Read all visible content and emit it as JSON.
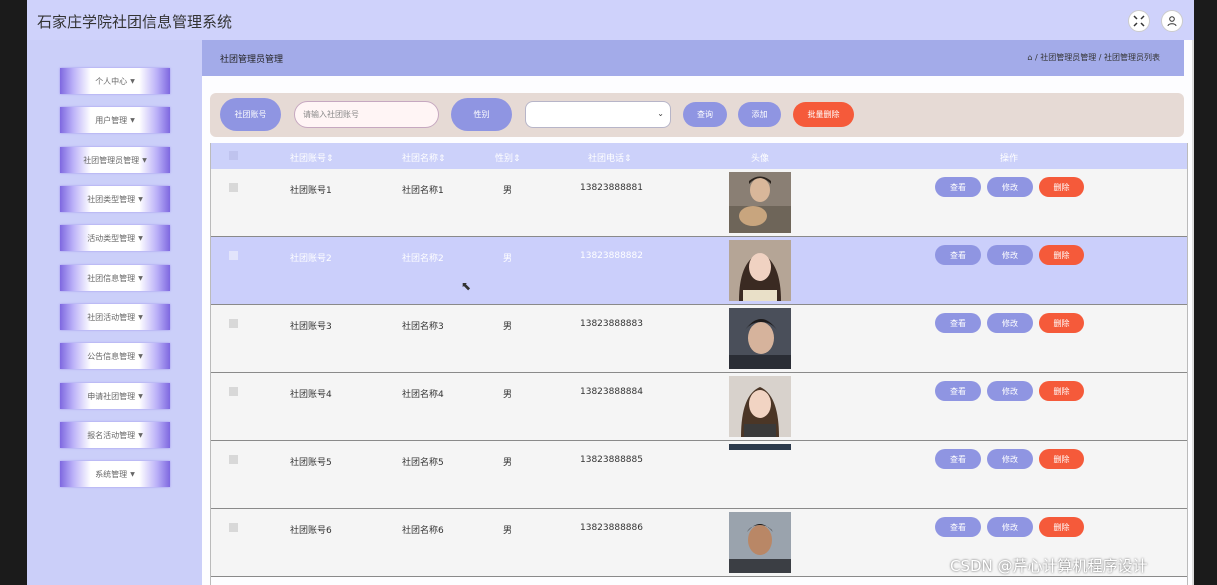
{
  "app": {
    "title": "石家庄学院社团信息管理系统"
  },
  "topbar": {
    "fullscreen_icon": "fullscreen-icon",
    "user_icon": "user-icon"
  },
  "sidebar": {
    "items": [
      {
        "label": "个人中心"
      },
      {
        "label": "用户管理"
      },
      {
        "label": "社团管理员管理"
      },
      {
        "label": "社团类型管理"
      },
      {
        "label": "活动类型管理"
      },
      {
        "label": "社团信息管理"
      },
      {
        "label": "社团活动管理"
      },
      {
        "label": "公告信息管理"
      },
      {
        "label": "申请社团管理"
      },
      {
        "label": "报名活动管理"
      },
      {
        "label": "系统管理"
      }
    ]
  },
  "header": {
    "page_title": "社团管理员管理",
    "breadcrumb": "/ 社团管理员管理 / 社团管理员列表"
  },
  "filter": {
    "account_label": "社团账号",
    "account_placeholder": "请输入社团账号",
    "gender_label": "性别",
    "gender_value": "",
    "query_label": "查询",
    "add_label": "添加",
    "batch_delete_label": "批量删除"
  },
  "table": {
    "columns": [
      "社团账号",
      "社团名称",
      "性别",
      "社团电话",
      "头像",
      "操作"
    ],
    "actions": {
      "view": "查看",
      "edit": "修改",
      "delete": "删除"
    },
    "rows": [
      {
        "account": "社团账号1",
        "name": "社团名称1",
        "gender": "男",
        "phone": "13823888881"
      },
      {
        "account": "社团账号2",
        "name": "社团名称2",
        "gender": "男",
        "phone": "13823888882"
      },
      {
        "account": "社团账号3",
        "name": "社团名称3",
        "gender": "男",
        "phone": "13823888883"
      },
      {
        "account": "社团账号4",
        "name": "社团名称4",
        "gender": "男",
        "phone": "13823888884"
      },
      {
        "account": "社团账号5",
        "name": "社团名称5",
        "gender": "男",
        "phone": "13823888885"
      },
      {
        "account": "社团账号6",
        "name": "社团名称6",
        "gender": "男",
        "phone": "13823888886"
      }
    ]
  },
  "watermark": "CSDN @芹心计算机程序设计",
  "colors": {
    "accent": "#8f95e2",
    "danger": "#f55a3a",
    "topbar": "#cfd2fb",
    "sidebar": "#cbcff9",
    "highlight_row": "#cbcffb"
  }
}
